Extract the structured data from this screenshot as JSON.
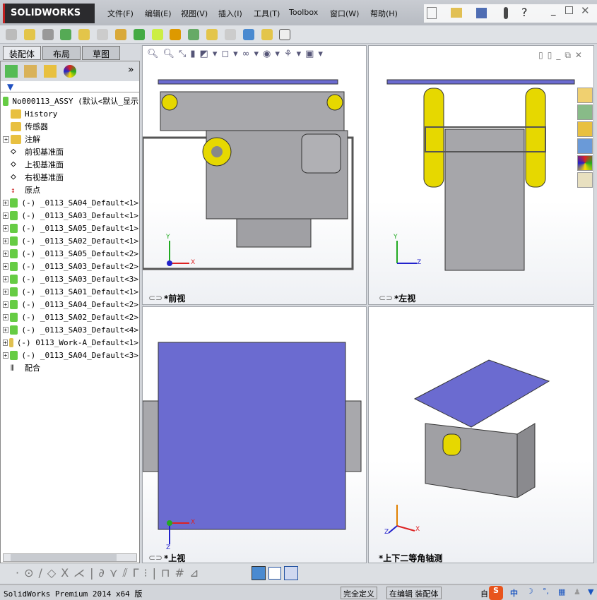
{
  "app": {
    "logo": "SOLIDWORKS"
  },
  "menu": [
    "文件(F)",
    "编辑(E)",
    "视图(V)",
    "插入(I)",
    "工具(T)",
    "Toolbox",
    "窗口(W)",
    "帮助(H)"
  ],
  "tabs": [
    "装配体",
    "布局",
    "草图"
  ],
  "tree": {
    "root": "No000113_ASSY  (默认<默认_显示",
    "items": [
      {
        "label": "History",
        "icon": "history-icon",
        "plus": false
      },
      {
        "label": "传感器",
        "icon": "sensor-icon",
        "plus": false
      },
      {
        "label": "注解",
        "icon": "annotation-icon",
        "plus": true
      },
      {
        "label": "前视基准面",
        "icon": "plane-icon",
        "plus": false
      },
      {
        "label": "上视基准面",
        "icon": "plane-icon",
        "plus": false
      },
      {
        "label": "右视基准面",
        "icon": "plane-icon",
        "plus": false
      },
      {
        "label": "原点",
        "icon": "origin-icon",
        "plus": false
      },
      {
        "label": "(-) _0113_SA04_Default<1>",
        "icon": "subassembly-icon",
        "plus": true
      },
      {
        "label": "(-) _0113_SA03_Default<1>",
        "icon": "subassembly-icon",
        "plus": true
      },
      {
        "label": "(-) _0113_SA05_Default<1>",
        "icon": "subassembly-icon",
        "plus": true
      },
      {
        "label": "(-) _0113_SA02_Default<1>",
        "icon": "subassembly-icon",
        "plus": true
      },
      {
        "label": "(-) _0113_SA05_Default<2>",
        "icon": "subassembly-icon",
        "plus": true
      },
      {
        "label": "(-) _0113_SA03_Default<2>",
        "icon": "subassembly-icon",
        "plus": true
      },
      {
        "label": "(-) _0113_SA03_Default<3>",
        "icon": "subassembly-icon",
        "plus": true
      },
      {
        "label": "(-) _0113_SA01_Default<1>",
        "icon": "subassembly-icon",
        "plus": true
      },
      {
        "label": "(-) _0113_SA04_Default<2>",
        "icon": "subassembly-icon",
        "plus": true
      },
      {
        "label": "(-) _0113_SA02_Default<2>",
        "icon": "subassembly-icon",
        "plus": true
      },
      {
        "label": "(-) _0113_SA03_Default<4>",
        "icon": "subassembly-icon",
        "plus": true
      },
      {
        "label": "(-) 0113_Work-A_Default<1>",
        "icon": "part-icon",
        "plus": true
      },
      {
        "label": "(-) _0113_SA04_Default<3>",
        "icon": "subassembly-icon",
        "plus": true
      },
      {
        "label": "配合",
        "icon": "mates-icon",
        "plus": false
      }
    ]
  },
  "viewports": {
    "front": "*前视",
    "left": "*左视",
    "top": "*上视",
    "iso": "*上下二等角轴测"
  },
  "axes": {
    "x": "X",
    "y": "Y",
    "z": "Z"
  },
  "status": {
    "product": "SolidWorks Premium 2014 x64 版",
    "defined": "完全定义",
    "editing": "在编辑 装配体",
    "custom": "自",
    "ime": "中"
  },
  "colors": {
    "plate": "#6b6bd0",
    "belt": "#e6d800",
    "frame": "#9a9a9a"
  }
}
